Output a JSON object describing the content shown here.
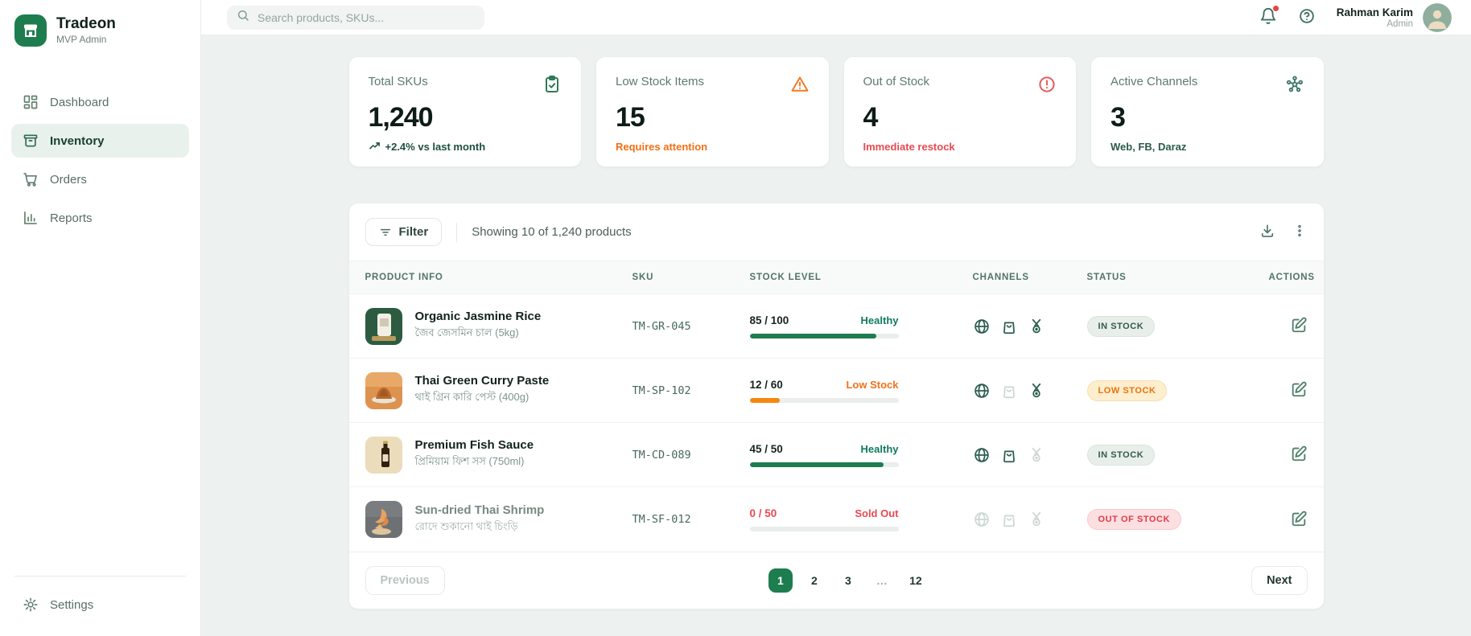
{
  "brand": {
    "name": "Tradeon",
    "subtitle": "MVP Admin"
  },
  "topbar": {
    "search_placeholder": "Search products, SKUs...",
    "user_name": "Rahman Karim",
    "user_role": "Admin"
  },
  "sidebar": {
    "items": [
      {
        "label": "Dashboard",
        "icon": "dashboard-grid-icon",
        "active": false
      },
      {
        "label": "Inventory",
        "icon": "inventory-box-icon",
        "active": true
      },
      {
        "label": "Orders",
        "icon": "cart-icon",
        "active": false
      },
      {
        "label": "Reports",
        "icon": "bar-chart-icon",
        "active": false
      }
    ],
    "settings_label": "Settings"
  },
  "stats": [
    {
      "label": "Total SKUs",
      "value": "1,240",
      "sub": "+2.4% vs last month",
      "icon": "clipboard-check-icon"
    },
    {
      "label": "Low Stock Items",
      "value": "15",
      "sub": "Requires attention",
      "icon": "warning-triangle-icon"
    },
    {
      "label": "Out of Stock",
      "value": "4",
      "sub": "Immediate restock",
      "icon": "alert-circle-icon"
    },
    {
      "label": "Active Channels",
      "value": "3",
      "sub": "Web, FB, Daraz",
      "icon": "network-icon"
    }
  ],
  "inventory_panel": {
    "filter_label": "Filter",
    "showing_text": "Showing 10 of 1,240 products",
    "columns": [
      "PRODUCT INFO",
      "SKU",
      "STOCK LEVEL",
      "CHANNELS",
      "STATUS",
      "ACTIONS"
    ],
    "rows": [
      {
        "name": "Organic Jasmine Rice",
        "subtitle": "জৈব জেসমিন চাল (5kg)",
        "sku": "TM-GR-045",
        "stock": "85 / 100",
        "stock_pct": "85%",
        "state": "Healthy",
        "channels": {
          "web": true,
          "fb": true,
          "daraz": true
        },
        "status": "IN STOCK"
      },
      {
        "name": "Thai Green Curry Paste",
        "subtitle": "থাই গ্রিন কারি পেস্ট (400g)",
        "sku": "TM-SP-102",
        "stock": "12 / 60",
        "stock_pct": "20%",
        "state": "Low Stock",
        "channels": {
          "web": true,
          "fb": false,
          "daraz": true
        },
        "status": "LOW STOCK"
      },
      {
        "name": "Premium Fish Sauce",
        "subtitle": "প্রিমিয়াম ফিশ সস (750ml)",
        "sku": "TM-CD-089",
        "stock": "45 / 50",
        "stock_pct": "90%",
        "state": "Healthy",
        "channels": {
          "web": true,
          "fb": true,
          "daraz": false
        },
        "status": "IN STOCK"
      },
      {
        "name": "Sun-dried Thai Shrimp",
        "subtitle": "রোদে শুকানো থাই চিংড়ি",
        "sku": "TM-SF-012",
        "stock": "0 / 50",
        "stock_pct": "0%",
        "state": "Sold Out",
        "channels": {
          "web": false,
          "fb": false,
          "daraz": false
        },
        "status": "OUT OF STOCK"
      }
    ]
  },
  "pagination": {
    "previous_label": "Previous",
    "next_label": "Next",
    "pages": [
      "1",
      "2",
      "3",
      "…",
      "12"
    ],
    "active_page": "1"
  },
  "colors": {
    "brand_green": "#1e7d4f",
    "healthy_green": "#117a5f",
    "warning_orange": "#f4711a",
    "danger_red": "#e8494f"
  }
}
